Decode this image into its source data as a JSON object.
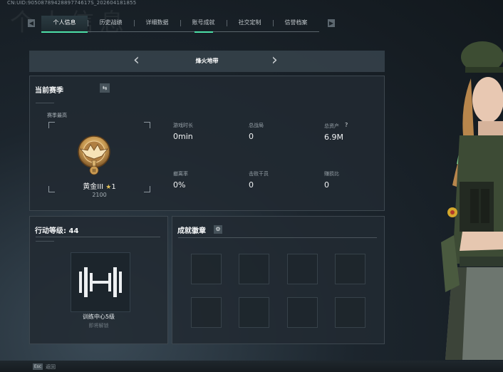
{
  "header": {
    "uid": "CN:UID:9050878942889774617S_202604181855",
    "ghost_title": "个人信息"
  },
  "tabs": {
    "prev_icon": "chevron-left-icon",
    "next_icon": "chevron-right-icon",
    "items": [
      {
        "label": "个人信息",
        "active": true
      },
      {
        "label": "历史战绩",
        "active": false
      },
      {
        "label": "详细数据",
        "active": false
      },
      {
        "label": "账号成就",
        "active": false
      },
      {
        "label": "社交定制",
        "active": false
      },
      {
        "label": "信誉档案",
        "active": false
      }
    ]
  },
  "map_selector": {
    "title": "烽火地带",
    "prev": "‹",
    "next": "›"
  },
  "season": {
    "title": "当前赛季",
    "swap_icon": "swap-icon",
    "peak_label": "赛季最高",
    "rank_name": "黄金III",
    "rank_stars": "1",
    "rank_score": "2100",
    "stats": [
      {
        "label": "游戏时长",
        "value": "0min"
      },
      {
        "label": "总战局",
        "value": "0"
      },
      {
        "label": "总资产",
        "value": "6.9M",
        "help": "?"
      },
      {
        "label": "撤离率",
        "value": "0%"
      },
      {
        "label": "击败干员",
        "value": "0"
      },
      {
        "label": "赚损比",
        "value": "0"
      }
    ]
  },
  "level": {
    "title": "行动等级: 44",
    "train_name": "训练中心5级",
    "train_sub": "即将解锁"
  },
  "badges": {
    "title": "成就徽章",
    "settings_icon": "gear-icon",
    "slot_count": 8
  },
  "footer": {
    "key": "Esc",
    "label": "返回"
  },
  "colors": {
    "accent": "#4de0a8",
    "gold": "#c99a52"
  }
}
